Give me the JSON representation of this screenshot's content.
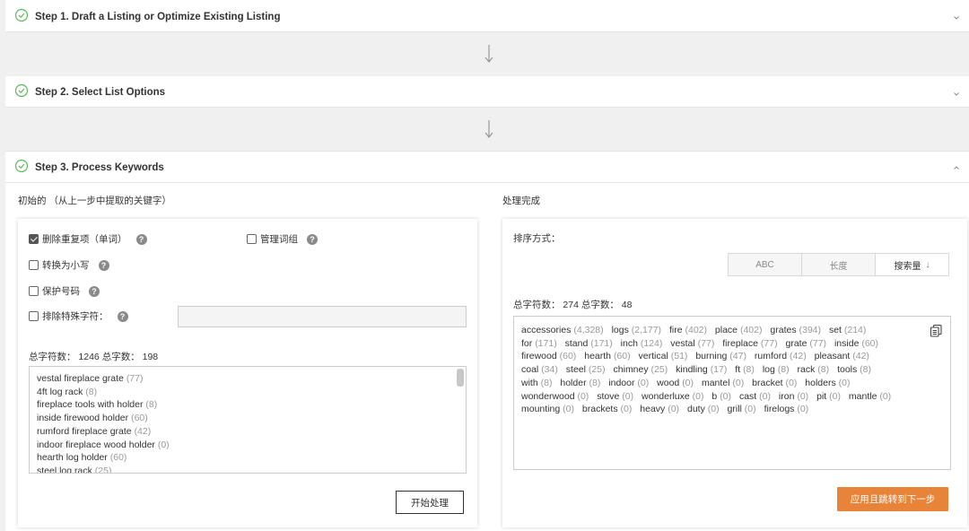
{
  "steps": [
    {
      "title": "Step 1. Draft a Listing or Optimize Existing Listing"
    },
    {
      "title": "Step 2. Select List Options"
    },
    {
      "title": "Step 3. Process Keywords"
    }
  ],
  "left": {
    "section_label": "初始的 （从上一步中提取的关键字）",
    "options": {
      "dedupe": {
        "label": "删除重复项（单词）",
        "checked": true
      },
      "manage_phrases": {
        "label": "管理词组",
        "checked": false
      },
      "lowercase": {
        "label": "转换为小写",
        "checked": false
      },
      "protect_numbers": {
        "label": "保护号码",
        "checked": false
      },
      "exclude_special": {
        "label": "排除特殊字符：",
        "checked": false
      }
    },
    "special_chars_value": "",
    "stats_text": "总字符数： 1246 总字数： 198",
    "keywords": [
      {
        "text": "vestal fireplace grate",
        "count": "(77)"
      },
      {
        "text": "4ft log rack",
        "count": "(8)"
      },
      {
        "text": "fireplace tools with holder",
        "count": "(8)"
      },
      {
        "text": "inside firewood holder",
        "count": "(60)"
      },
      {
        "text": "rumford fireplace grate",
        "count": "(42)"
      },
      {
        "text": "indoor fireplace wood holder",
        "count": "(0)"
      },
      {
        "text": "hearth log holder",
        "count": "(60)"
      },
      {
        "text": "steel log rack",
        "count": "(25)"
      }
    ],
    "start_button": "开始处理"
  },
  "right": {
    "section_label": "处理完成",
    "sort_label": "排序方式：",
    "sort_options": [
      "ABC",
      "长度",
      "搜索量"
    ],
    "sort_active": "搜索量",
    "stats_text": "总字符数： 274 总字数： 48",
    "words": [
      {
        "w": "accessories",
        "c": "(4,328)"
      },
      {
        "w": "logs",
        "c": "(2,177)"
      },
      {
        "w": "fire",
        "c": "(402)"
      },
      {
        "w": "place",
        "c": "(402)"
      },
      {
        "w": "grates",
        "c": "(394)"
      },
      {
        "w": "set",
        "c": "(214)"
      },
      {
        "w": "for",
        "c": "(171)"
      },
      {
        "w": "stand",
        "c": "(171)"
      },
      {
        "w": "inch",
        "c": "(124)"
      },
      {
        "w": "vestal",
        "c": "(77)"
      },
      {
        "w": "fireplace",
        "c": "(77)"
      },
      {
        "w": "grate",
        "c": "(77)"
      },
      {
        "w": "inside",
        "c": "(60)"
      },
      {
        "w": "firewood",
        "c": "(60)"
      },
      {
        "w": "hearth",
        "c": "(60)"
      },
      {
        "w": "vertical",
        "c": "(51)"
      },
      {
        "w": "burning",
        "c": "(47)"
      },
      {
        "w": "rumford",
        "c": "(42)"
      },
      {
        "w": "pleasant",
        "c": "(42)"
      },
      {
        "w": "coal",
        "c": "(34)"
      },
      {
        "w": "steel",
        "c": "(25)"
      },
      {
        "w": "chimney",
        "c": "(25)"
      },
      {
        "w": "kindling",
        "c": "(17)"
      },
      {
        "w": "ft",
        "c": "(8)"
      },
      {
        "w": "log",
        "c": "(8)"
      },
      {
        "w": "rack",
        "c": "(8)"
      },
      {
        "w": "tools",
        "c": "(8)"
      },
      {
        "w": "with",
        "c": "(8)"
      },
      {
        "w": "holder",
        "c": "(8)"
      },
      {
        "w": "indoor",
        "c": "(0)"
      },
      {
        "w": "wood",
        "c": "(0)"
      },
      {
        "w": "mantel",
        "c": "(0)"
      },
      {
        "w": "bracket",
        "c": "(0)"
      },
      {
        "w": "holders",
        "c": "(0)"
      },
      {
        "w": "wonderwood",
        "c": "(0)"
      },
      {
        "w": "stove",
        "c": "(0)"
      },
      {
        "w": "wonderluxe",
        "c": "(0)"
      },
      {
        "w": "b",
        "c": "(0)"
      },
      {
        "w": "cast",
        "c": "(0)"
      },
      {
        "w": "iron",
        "c": "(0)"
      },
      {
        "w": "pit",
        "c": "(0)"
      },
      {
        "w": "mantle",
        "c": "(0)"
      },
      {
        "w": "mounting",
        "c": "(0)"
      },
      {
        "w": "brackets",
        "c": "(0)"
      },
      {
        "w": "heavy",
        "c": "(0)"
      },
      {
        "w": "duty",
        "c": "(0)"
      },
      {
        "w": "grill",
        "c": "(0)"
      },
      {
        "w": "firelogs",
        "c": "(0)"
      }
    ],
    "apply_button": "应用且跳转到下一步"
  },
  "colors": {
    "check_green": "#5cb85c",
    "accent_orange": "#e8833a"
  },
  "icons": {
    "step_status": "check-circle-icon",
    "collapse": "chevron-icon",
    "copy": "copy-icon",
    "help": "help-icon"
  }
}
